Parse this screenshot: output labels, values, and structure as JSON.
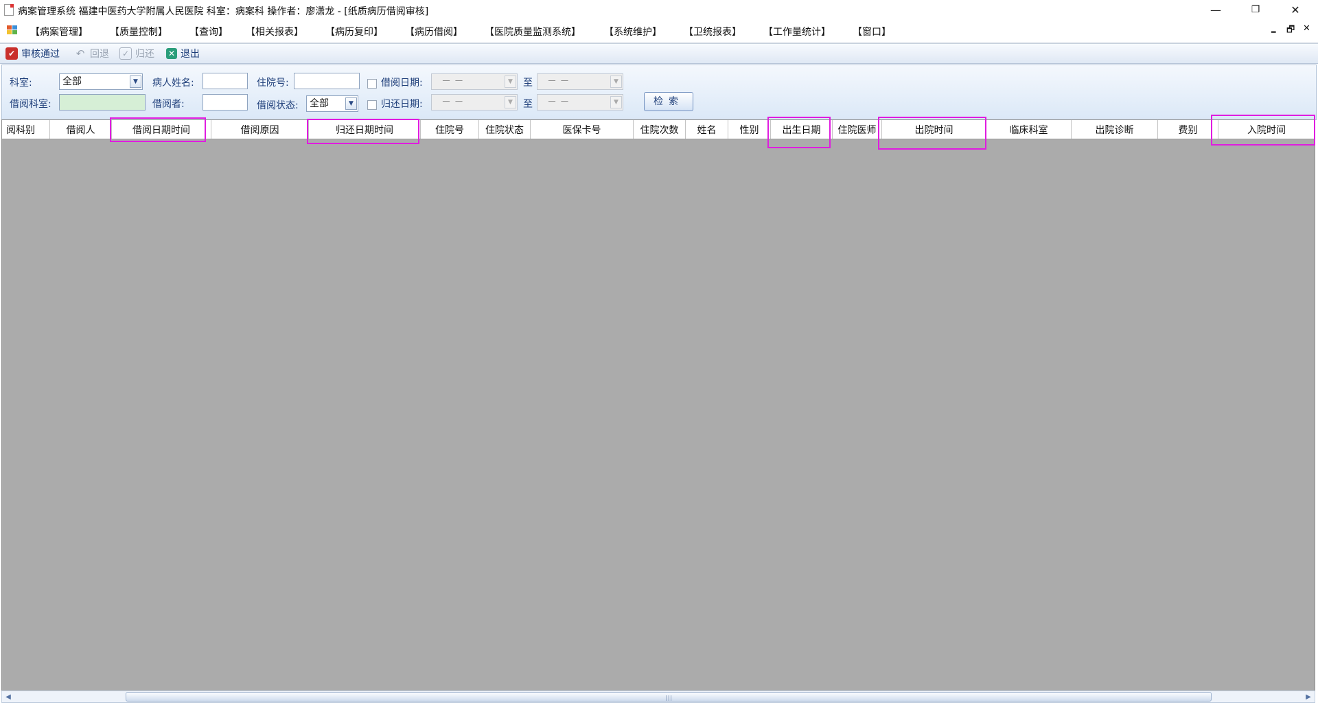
{
  "window": {
    "title": "病案管理系统  福建中医药大学附属人民医院  科室：病案科  操作者：廖潇龙 - [纸质病历借阅审核]",
    "minimize": "—",
    "restore": "❐",
    "close": "✕"
  },
  "menu": {
    "items": [
      "【病案管理】",
      "【质量控制】",
      "【查询】",
      "【相关报表】",
      "【病历复印】",
      "【病历借阅】",
      "【医院质量监测系统】",
      "【系统维护】",
      "【卫统报表】",
      "【工作量统计】",
      "【窗口】"
    ],
    "mdi_minimize": "‗",
    "mdi_restore": "🗗",
    "mdi_close": "✕"
  },
  "toolbar": {
    "approve": "审核通过",
    "rollback": "回退",
    "return": "归还",
    "exit": "退出"
  },
  "filter": {
    "dept_label": "科室:",
    "dept_value": "全部",
    "patient_name_label": "病人姓名:",
    "patient_name_value": "",
    "admission_no_label": "住院号:",
    "admission_no_value": "",
    "borrow_date_label": "借阅日期:",
    "borrow_date_from": "－  －",
    "to_label": "至",
    "borrow_date_to": "－  －",
    "borrow_dept_label": "借阅科室:",
    "borrow_dept_value": "",
    "borrower_label": "借阅者:",
    "borrower_value": "",
    "status_label": "借阅状态:",
    "status_value": "全部",
    "return_date_label": "归还日期:",
    "return_date_from": "－  －",
    "to_label2": "至",
    "return_date_to": "－  －",
    "search_button": "检索"
  },
  "grid": {
    "columns": [
      "阅科别",
      "借阅人",
      "借阅日期时间",
      "借阅原因",
      "归还日期时间",
      "住院号",
      "住院状态",
      "医保卡号",
      "住院次数",
      "姓名",
      "性别",
      "出生日期",
      "住院医师",
      "出院时间",
      "临床科室",
      "出院诊断",
      "费别",
      "入院时间"
    ],
    "rows": []
  },
  "colors": {
    "highlight": "#e01ce0",
    "grid_background": "#ababab",
    "label_text": "#1f3f7a"
  }
}
